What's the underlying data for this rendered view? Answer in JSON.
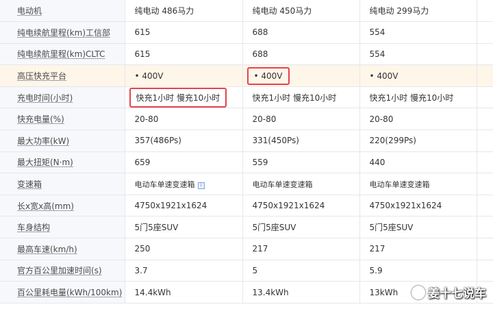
{
  "table": {
    "rows": [
      {
        "label": "电动机",
        "values": [
          "纯电动 486马力",
          "纯电动 450马力",
          "纯电动 299马力"
        ]
      },
      {
        "label": "纯电续航里程(km)工信部",
        "values": [
          "615",
          "688",
          "554"
        ]
      },
      {
        "label": "纯电续航里程(km)CLTC",
        "values": [
          "615",
          "688",
          "554"
        ]
      },
      {
        "label": "高压快充平台",
        "values": [
          "• 400V",
          "• 400V",
          "• 400V"
        ]
      },
      {
        "label": "充电时间(小时)",
        "values": [
          "快充1小时 慢充10小时",
          "快充1小时 慢充10小时",
          "快充1小时 慢充10小时"
        ]
      },
      {
        "label": "快充电量(%)",
        "values": [
          "20-80",
          "20-80",
          "20-80"
        ]
      },
      {
        "label": "最大功率(kW)",
        "values": [
          "357(486Ps)",
          "331(450Ps)",
          "220(299Ps)"
        ]
      },
      {
        "label": "最大扭矩(N·m)",
        "values": [
          "659",
          "559",
          "440"
        ]
      },
      {
        "label": "变速箱",
        "values": [
          "电动车单速变速箱",
          "电动车单速变速箱",
          "电动车单速变速箱"
        ]
      },
      {
        "label": "长x宽x高(mm)",
        "values": [
          "4750x1921x1624",
          "4750x1921x1624",
          "4750x1921x1624"
        ]
      },
      {
        "label": "车身结构",
        "values": [
          "5门5座SUV",
          "5门5座SUV",
          "5门5座SUV"
        ]
      },
      {
        "label": "最高车速(km/h)",
        "values": [
          "250",
          "217",
          "217"
        ]
      },
      {
        "label": "官方百公里加速时间(s)",
        "values": [
          "3.7",
          "5",
          "5.9"
        ]
      },
      {
        "label": "百公里耗电量(kWh/100km)",
        "values": [
          "14.4kWh",
          "13.4kWh",
          "13kWh"
        ]
      }
    ]
  },
  "watermark": {
    "text": "姜十七说车"
  },
  "colors": {
    "highlight_row": "#fdf6e9",
    "label_bg": "#f7f8fb",
    "annotation_box": "#e5434c"
  }
}
